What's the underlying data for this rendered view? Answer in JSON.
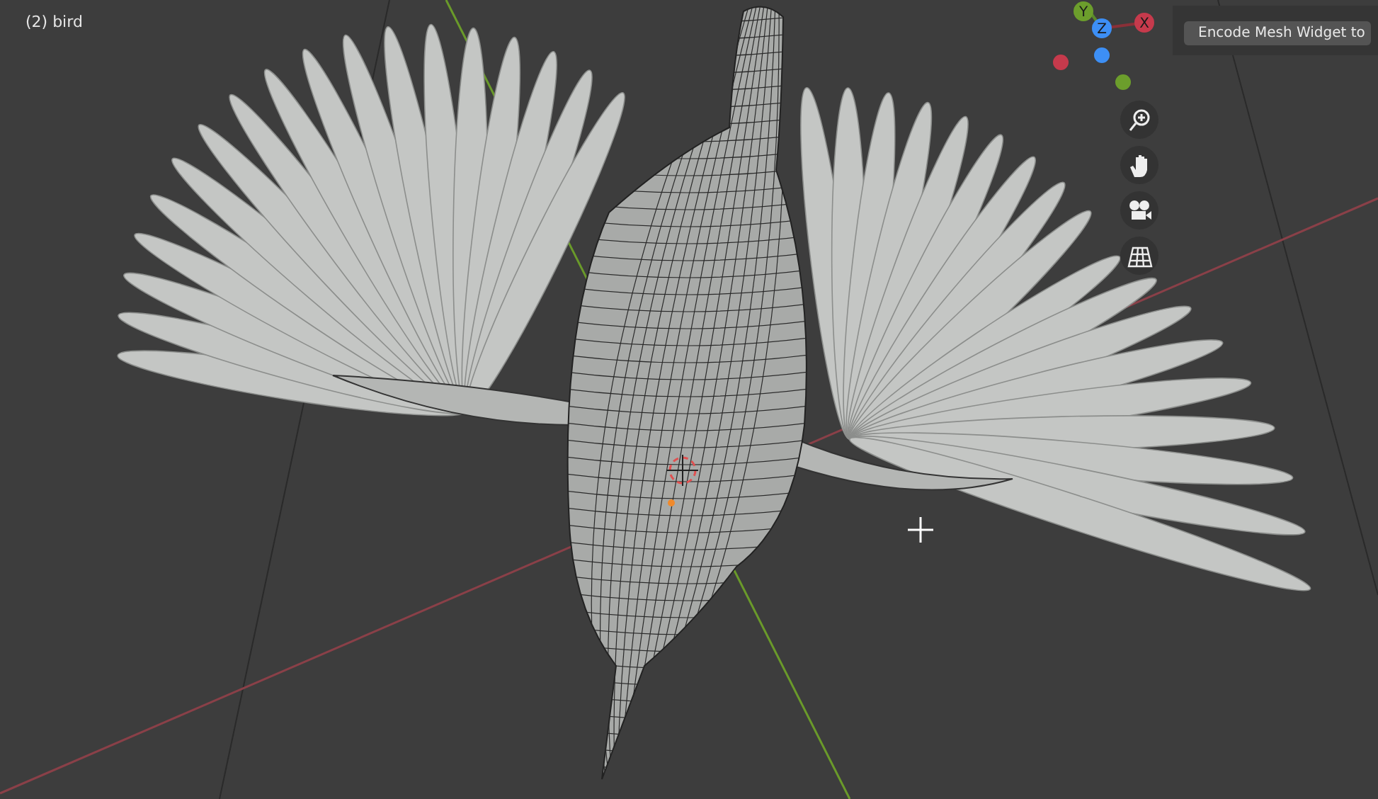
{
  "viewport": {
    "object_label": "(2) bird"
  },
  "nav_gizmo": {
    "axes": [
      {
        "label": "Y",
        "color": "#6c9e2c"
      },
      {
        "label": "X",
        "color": "#c63a4c"
      },
      {
        "label": "Z",
        "color": "#3d8ff5"
      }
    ]
  },
  "nav_buttons": [
    {
      "kind": "zoom"
    },
    {
      "kind": "pan"
    },
    {
      "kind": "camera"
    },
    {
      "kind": "ortho"
    }
  ],
  "panel": {
    "button": "Encode Mesh Widget to"
  }
}
